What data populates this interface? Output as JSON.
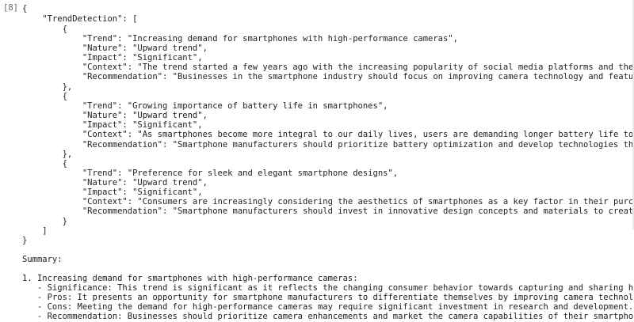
{
  "cell": {
    "prompt": "[8]"
  },
  "lines": [
    "{",
    "    \"TrendDetection\": [",
    "        {",
    "            \"Trend\": \"Increasing demand for smartphones with high-performance cameras\",",
    "            \"Nature\": \"Upward trend\",",
    "            \"Impact\": \"Significant\",",
    "            \"Context\": \"The trend started a few years ago with the increasing popularity of social media platforms and the rise of influencer cu",
    "            \"Recommendation\": \"Businesses in the smartphone industry should focus on improving camera technology and features to meet the growin",
    "        },",
    "        {",
    "            \"Trend\": \"Growing importance of battery life in smartphones\",",
    "            \"Nature\": \"Upward trend\",",
    "            \"Impact\": \"Significant\",",
    "            \"Context\": \"As smartphones become more integral to our daily lives, users are demanding longer battery life to ensure uninterrupted",
    "            \"Recommendation\": \"Smartphone manufacturers should prioritize battery optimization and develop technologies that enhance battery lif",
    "        },",
    "        {",
    "            \"Trend\": \"Preference for sleek and elegant smartphone designs\",",
    "            \"Nature\": \"Upward trend\",",
    "            \"Impact\": \"Significant\",",
    "            \"Context\": \"Consumers are increasingly considering the aesthetics of smartphones as a key factor in their purchasing decisions. Slee",
    "            \"Recommendation\": \"Smartphone manufacturers should invest in innovative design concepts and materials to create visually appealing d",
    "        }",
    "    ]",
    "}",
    "",
    "Summary:",
    "",
    "1. Increasing demand for smartphones with high-performance cameras:",
    "   - Significance: This trend is significant as it reflects the changing consumer behavior towards capturing and sharing high-quality photos and",
    "   - Pros: It presents an opportunity for smartphone manufacturers to differentiate themselves by improving camera technology and features.",
    "   - Cons: Meeting the demand for high-performance cameras may require significant investment in research and development.",
    "   - Recommendation: Businesses should prioritize camera enhancements and market the camera capabilities of their smartphones effectively."
  ]
}
